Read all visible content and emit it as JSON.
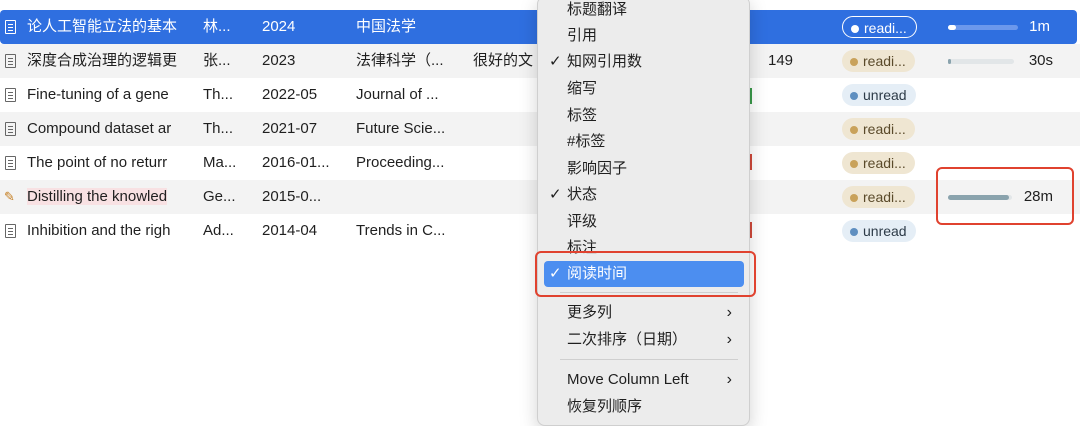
{
  "table": {
    "rows": [
      {
        "title": "论人工智能立法的基本",
        "author": "林...",
        "year": "2024",
        "journal": "中国法学",
        "extra": "",
        "number": "",
        "status": "readi...",
        "status_type": "reading",
        "progress": 0.12,
        "time": "1m",
        "selected": true,
        "icon": "document-icon"
      },
      {
        "title": "深度合成治理的逻辑更",
        "author": "张...",
        "year": "2023",
        "journal": "法律科学（...",
        "extra": "很好的文",
        "number": "149",
        "status": "readi...",
        "status_type": "reading",
        "progress": 0.02,
        "time": "30s",
        "selected": false,
        "icon": "document-icon"
      },
      {
        "title": "Fine-tuning of a gene",
        "author": "Th...",
        "year": "2022-05",
        "journal": "Journal of ...",
        "extra": "",
        "number": "",
        "status": "unread",
        "status_type": "unread",
        "progress": null,
        "time": "",
        "selected": false,
        "icon": "document-icon"
      },
      {
        "title": "Compound dataset ar",
        "author": "Th...",
        "year": "2021-07",
        "journal": "Future Scie...",
        "extra": "",
        "number": "",
        "status": "readi...",
        "status_type": "reading",
        "progress": null,
        "time": "",
        "selected": false,
        "icon": "document-icon"
      },
      {
        "title": "The point of no returr",
        "author": "Ma...",
        "year": "2016-01...",
        "journal": "Proceeding...",
        "extra": "",
        "number": "",
        "status": "readi...",
        "status_type": "reading",
        "progress": null,
        "time": "",
        "selected": false,
        "icon": "document-icon"
      },
      {
        "title": "Distilling the knowled",
        "author": "Ge...",
        "year": "2015-0...",
        "journal": "",
        "extra": "",
        "number": "",
        "status": "readi...",
        "status_type": "reading",
        "progress": 0.95,
        "time": "28m",
        "selected": false,
        "icon": "annotated-document-icon"
      },
      {
        "title": "Inhibition and the righ",
        "author": "Ad...",
        "year": "2014-04",
        "journal": "Trends in C...",
        "extra": "",
        "number": "",
        "status": "unread",
        "status_type": "unread",
        "progress": null,
        "time": "",
        "selected": false,
        "icon": "document-icon"
      }
    ]
  },
  "context_menu": {
    "items": [
      {
        "label": "标题翻译",
        "checked": false,
        "submenu": false,
        "active": false
      },
      {
        "label": "引用",
        "checked": false,
        "submenu": false,
        "active": false
      },
      {
        "label": "知网引用数",
        "checked": true,
        "submenu": false,
        "active": false
      },
      {
        "label": "缩写",
        "checked": false,
        "submenu": false,
        "active": false
      },
      {
        "label": "标签",
        "checked": false,
        "submenu": false,
        "active": false
      },
      {
        "label": "#标签",
        "checked": false,
        "submenu": false,
        "active": false
      },
      {
        "label": "影响因子",
        "checked": false,
        "submenu": false,
        "active": false
      },
      {
        "label": "状态",
        "checked": true,
        "submenu": false,
        "active": false
      },
      {
        "label": "评级",
        "checked": false,
        "submenu": false,
        "active": false
      },
      {
        "label": "标注",
        "checked": false,
        "submenu": false,
        "active": false
      },
      {
        "label": "阅读时间",
        "checked": true,
        "submenu": false,
        "active": true
      },
      {
        "label": "更多列",
        "checked": false,
        "submenu": true,
        "active": false
      },
      {
        "label": "二次排序（日期）",
        "checked": false,
        "submenu": true,
        "active": false
      },
      {
        "label": "Move Column Left",
        "checked": false,
        "submenu": true,
        "active": false
      },
      {
        "label": "恢复列顺序",
        "checked": false,
        "submenu": false,
        "active": false
      }
    ],
    "check_glyph": "✓",
    "arrow_glyph": "›"
  },
  "colors": {
    "selection": "#2f6fe0",
    "menu_active": "#4c8ef0",
    "callout_frame": "#e0422f",
    "reading_badge": "#efe6d2",
    "unread_badge": "#e5eef6"
  }
}
